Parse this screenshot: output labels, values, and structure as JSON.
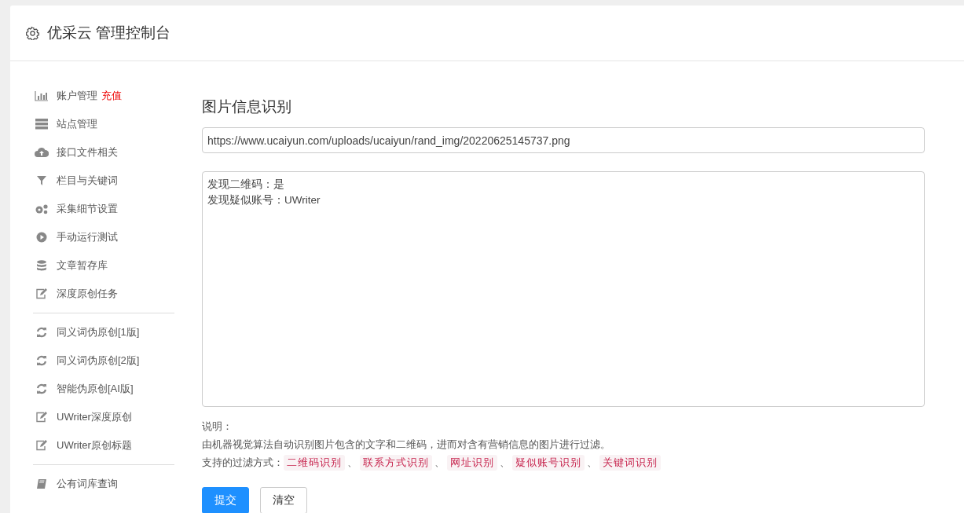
{
  "header": {
    "title": "优采云 管理控制台"
  },
  "sidebar": {
    "groups": [
      {
        "items": [
          {
            "label": "账户管理",
            "badge": "充值",
            "kind": "chart"
          },
          {
            "label": "站点管理",
            "kind": "server"
          },
          {
            "label": "接口文件相关",
            "kind": "cloud"
          },
          {
            "label": "栏目与关键词",
            "kind": "filter"
          },
          {
            "label": "采集细节设置",
            "kind": "gears"
          },
          {
            "label": "手动运行测试",
            "kind": "play"
          },
          {
            "label": "文章暂存库",
            "kind": "database"
          },
          {
            "label": "深度原创任务",
            "kind": "edit"
          }
        ]
      },
      {
        "items": [
          {
            "label": "同义词伪原创[1版]",
            "kind": "refresh"
          },
          {
            "label": "同义词伪原创[2版]",
            "kind": "refresh"
          },
          {
            "label": "智能伪原创[AI版]",
            "kind": "refresh"
          },
          {
            "label": "UWriter深度原创",
            "kind": "edit"
          },
          {
            "label": "UWriter原创标题",
            "kind": "edit"
          }
        ]
      },
      {
        "items": [
          {
            "label": "公有词库查询",
            "kind": "book"
          }
        ]
      }
    ]
  },
  "main": {
    "title": "图片信息识别",
    "url_field": {
      "value": "https://www.ucaiyun.com/uploads/ucaiyun/rand_img/20220625145737.png"
    },
    "result": {
      "lines": [
        "发现二维码：是",
        "发现疑似账号：UWriter"
      ]
    },
    "note_label": "说明：",
    "note": "由机器视觉算法自动识别图片包含的文字和二维码，进而对含有营销信息的图片进行过滤。",
    "methods_label": "支持的过滤方式：",
    "methods": [
      "二维码识别",
      "联系方式识别",
      "网址识别",
      "疑似账号识别",
      "关键词识别"
    ],
    "separator": "、",
    "buttons": [
      {
        "label": "提交",
        "kind": "primary"
      },
      {
        "label": "清空",
        "kind": "default"
      }
    ]
  }
}
